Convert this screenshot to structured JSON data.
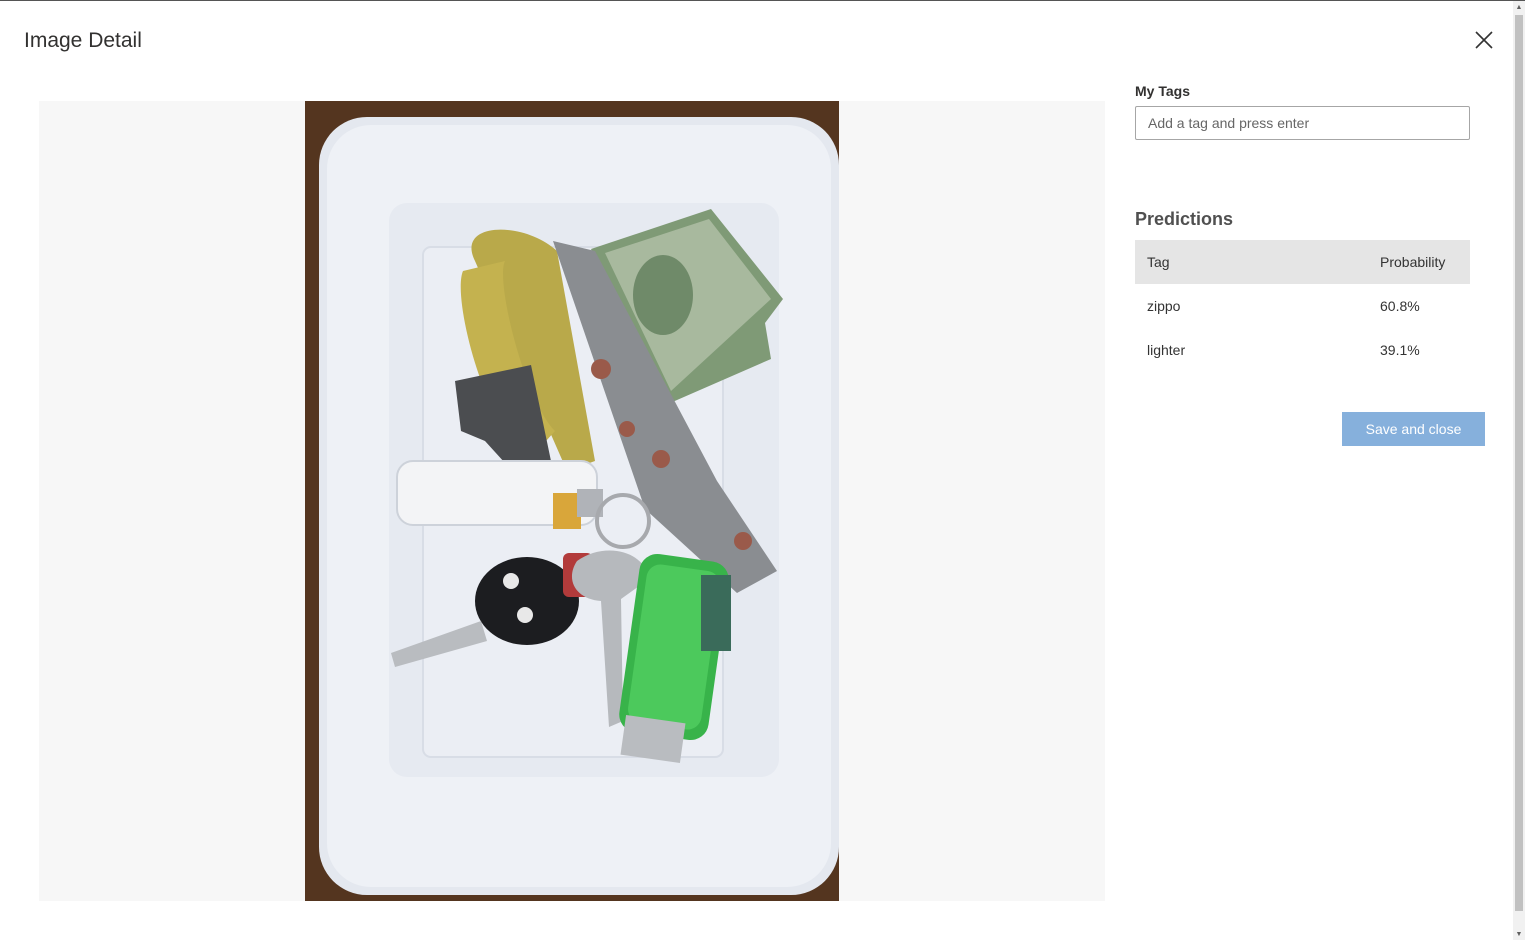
{
  "dialog": {
    "title": "Image Detail",
    "close_icon": "close-icon"
  },
  "image": {
    "description_icon": "photo"
  },
  "tags": {
    "label": "My Tags",
    "placeholder": "Add a tag and press enter",
    "value": ""
  },
  "predictions": {
    "title": "Predictions",
    "columns": [
      "Tag",
      "Probability"
    ],
    "rows": [
      {
        "tag": "zippo",
        "probability": "60.8%"
      },
      {
        "tag": "lighter",
        "probability": "39.1%"
      }
    ]
  },
  "actions": {
    "save_label": "Save and close"
  },
  "colors": {
    "accent": "#86b0dc",
    "header_bg": "#e5e5e5",
    "image_bg": "#f7f7f7"
  }
}
